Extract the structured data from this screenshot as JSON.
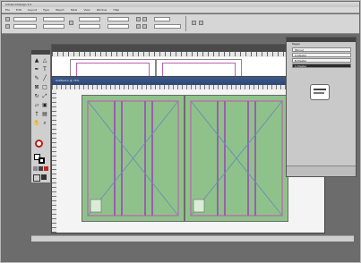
{
  "app": {
    "title": "Adobe InDesign 2.0"
  },
  "menubar": {
    "items": [
      "File",
      "Edit",
      "Layout",
      "Type",
      "Object",
      "Table",
      "View",
      "Window",
      "Help"
    ]
  },
  "document_front": {
    "title": "Untitled-1 @ 75%"
  },
  "panel": {
    "title": "Pages",
    "items": [
      "[None]",
      "A-Master",
      "B-Master",
      "C-Master"
    ]
  },
  "colors": {
    "page_fill": "#8fc28b",
    "margin_guide": "#c060b0",
    "column_guide": "#9a5fb0",
    "workspace": "#6c6c6c"
  }
}
